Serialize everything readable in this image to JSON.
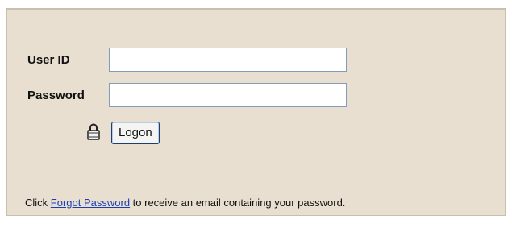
{
  "form": {
    "user_id_label": "User ID",
    "user_id_value": "",
    "password_label": "Password",
    "password_value": "",
    "logon_label": "Logon",
    "lock_icon": "lock-icon"
  },
  "footer": {
    "prefix": "Click ",
    "link_text": "Forgot Password",
    "suffix": " to receive an email containing your password."
  },
  "colors": {
    "panel_background": "#e9dfd0",
    "link": "#1a3fb5",
    "input_border": "#7f9db9"
  }
}
